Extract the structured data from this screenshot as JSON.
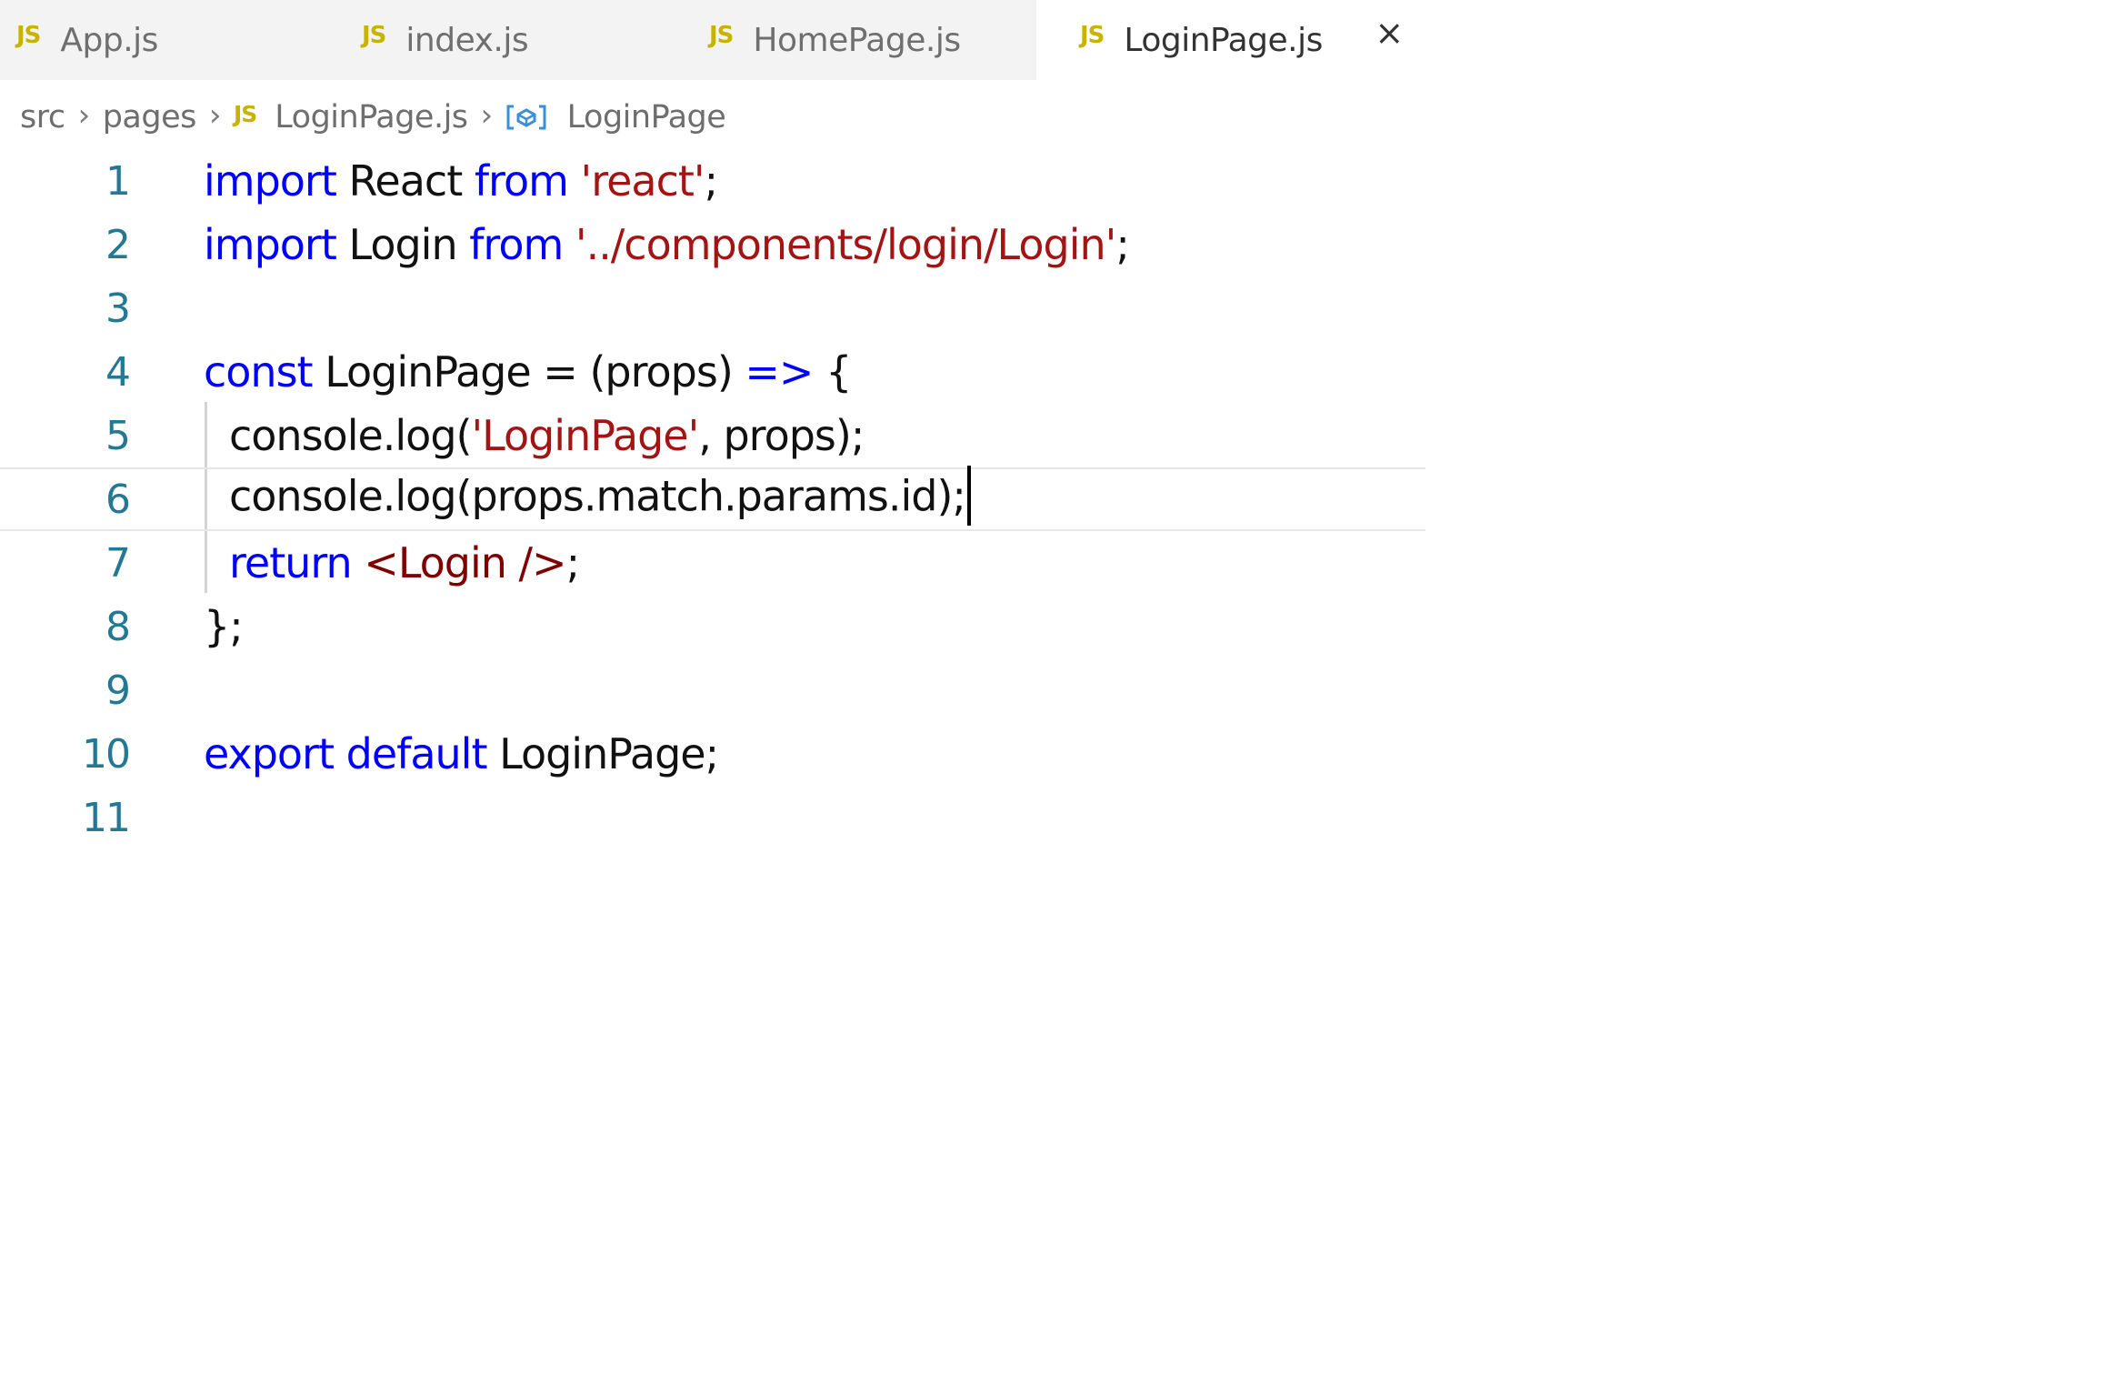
{
  "tabs": [
    {
      "icon": "JS",
      "label": "App.js",
      "active": false
    },
    {
      "icon": "JS",
      "label": "index.js",
      "active": false
    },
    {
      "icon": "JS",
      "label": "HomePage.js",
      "active": false
    },
    {
      "icon": "JS",
      "label": "LoginPage.js",
      "active": true,
      "close": "×"
    }
  ],
  "breadcrumb": {
    "seg1": "src",
    "seg2": "pages",
    "file_icon": "JS",
    "file": "LoginPage.js",
    "symbol_icon": "[⊘]",
    "symbol": "LoginPage",
    "separator": "›"
  },
  "editor": {
    "line_numbers": [
      "1",
      "2",
      "3",
      "4",
      "5",
      "6",
      "7",
      "8",
      "9",
      "10",
      "11"
    ],
    "line1": {
      "kw1": "import",
      "t1": " React ",
      "kw2": "from",
      "t2": " ",
      "str": "'react'",
      "t3": ";"
    },
    "line2": {
      "kw1": "import",
      "t1": " Login ",
      "kw2": "from",
      "t2": " ",
      "str": "'../components/login/Login'",
      "t3": ";"
    },
    "line4": {
      "kw1": "const",
      "t1": " LoginPage = (props) ",
      "kw2": "=>",
      "t2": " {"
    },
    "line5": {
      "t1": "console.log(",
      "str": "'LoginPage'",
      "t2": ", props);"
    },
    "line6": {
      "t1": "console.log(props.match.params.id);"
    },
    "line7": {
      "kw1": "return",
      "t1": " ",
      "tag": "<Login />",
      "t2": ";"
    },
    "line8": {
      "t1": "};"
    },
    "line10": {
      "kw1": "export",
      "t1": " ",
      "kw2": "default",
      "t2": " LoginPage;"
    }
  },
  "colors": {
    "keyword": "#0000ff",
    "string": "#a31515",
    "jsx_tag": "#800000",
    "line_number": "#237893",
    "js_icon": "#c8b400",
    "symbol_icon": "#3b8fd6"
  }
}
